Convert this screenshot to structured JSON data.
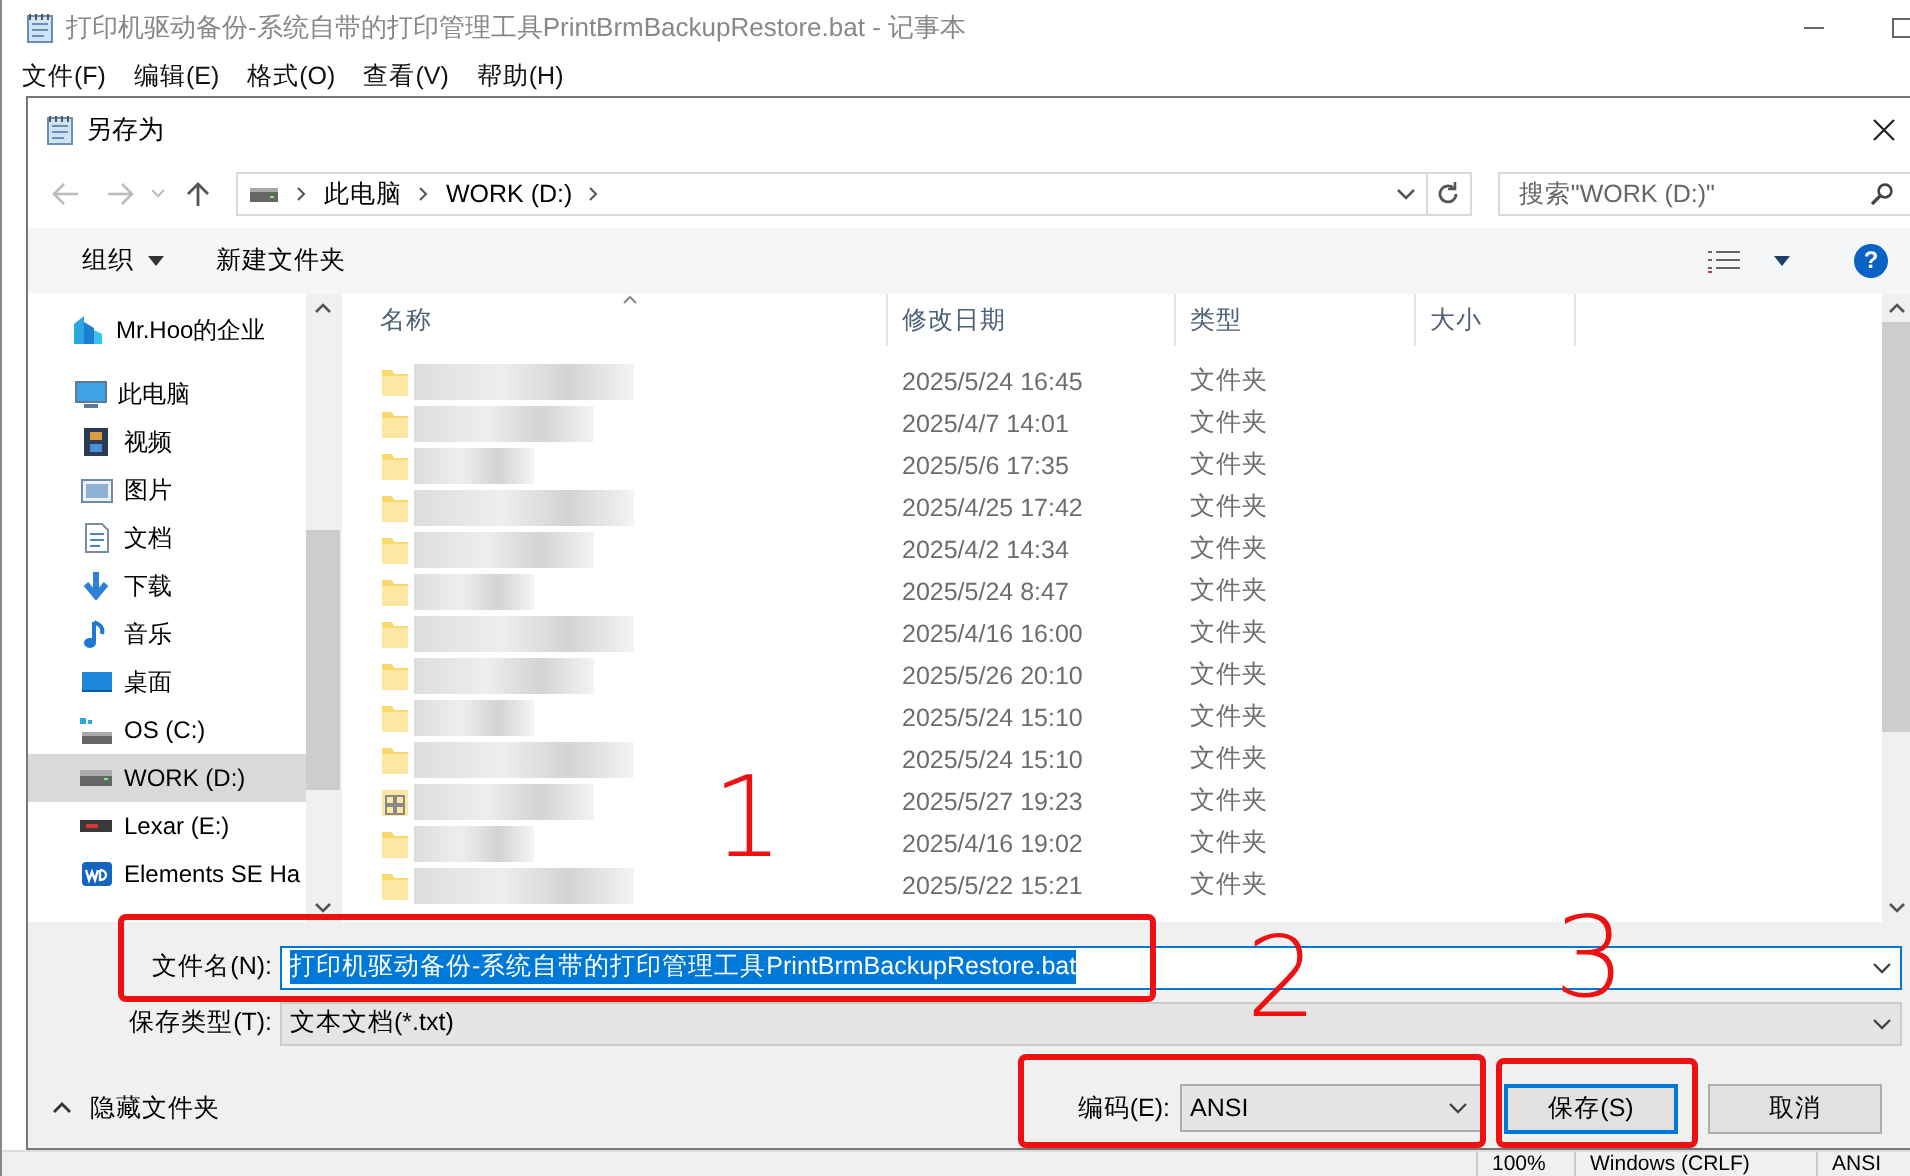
{
  "notepad": {
    "title": "打印机驱动备份-系统自带的打印管理工具PrintBrmBackupRestore.bat - 记事本",
    "menu": [
      "文件(F)",
      "编辑(E)",
      "格式(O)",
      "查看(V)",
      "帮助(H)"
    ],
    "status_bar": [
      "100%",
      "Windows (CRLF)",
      "ANSI"
    ]
  },
  "dialog": {
    "title": "另存为",
    "address": {
      "path": [
        "此电脑",
        "WORK (D:)"
      ]
    },
    "search": {
      "placeholder": "搜索\"WORK (D:)\""
    },
    "toolbar": {
      "organize": "组织",
      "new_folder": "新建文件夹",
      "help": "?"
    },
    "sidebar": {
      "items": [
        {
          "kind": "cloud",
          "label": "Mr.Hoo的企业",
          "selected": false
        },
        {
          "kind": "pc",
          "label": "此电脑",
          "selected": false
        },
        {
          "kind": "video",
          "label": "视频",
          "selected": false
        },
        {
          "kind": "picture",
          "label": "图片",
          "selected": false
        },
        {
          "kind": "document",
          "label": "文档",
          "selected": false
        },
        {
          "kind": "download",
          "label": "下载",
          "selected": false
        },
        {
          "kind": "music",
          "label": "音乐",
          "selected": false
        },
        {
          "kind": "desktop",
          "label": "桌面",
          "selected": false
        },
        {
          "kind": "osdrive",
          "label": "OS (C:)",
          "selected": false
        },
        {
          "kind": "drive",
          "label": "WORK (D:)",
          "selected": true
        },
        {
          "kind": "usb",
          "label": "Lexar (E:)",
          "selected": false
        },
        {
          "kind": "wd",
          "label": "Elements SE Ha",
          "selected": false
        }
      ]
    },
    "table": {
      "columns": [
        "名称",
        "修改日期",
        "类型",
        "大小"
      ],
      "rows": [
        {
          "kind": "folder",
          "date": "2025/5/24 16:45",
          "type": "文件夹"
        },
        {
          "kind": "folder",
          "date": "2025/4/7 14:01",
          "type": "文件夹"
        },
        {
          "kind": "folder",
          "date": "2025/5/6 17:35",
          "type": "文件夹"
        },
        {
          "kind": "folder",
          "date": "2025/4/25 17:42",
          "type": "文件夹"
        },
        {
          "kind": "folder",
          "date": "2025/4/2 14:34",
          "type": "文件夹"
        },
        {
          "kind": "folder",
          "date": "2025/5/24 8:47",
          "type": "文件夹"
        },
        {
          "kind": "folder",
          "date": "2025/4/16 16:00",
          "type": "文件夹"
        },
        {
          "kind": "folder",
          "date": "2025/5/26 20:10",
          "type": "文件夹"
        },
        {
          "kind": "folder",
          "date": "2025/5/24 15:10",
          "type": "文件夹"
        },
        {
          "kind": "folder",
          "date": "2025/5/24 15:10",
          "type": "文件夹"
        },
        {
          "kind": "app",
          "date": "2025/5/27 19:23",
          "type": "文件夹"
        },
        {
          "kind": "folder",
          "date": "2025/4/16 19:02",
          "type": "文件夹"
        },
        {
          "kind": "folder",
          "date": "2025/5/22 15:21",
          "type": "文件夹"
        }
      ]
    },
    "filename": {
      "label": "文件名(N):",
      "value": "打印机驱动备份-系统自带的打印管理工具PrintBrmBackupRestore.bat"
    },
    "filetype": {
      "label": "保存类型(T):",
      "value": "文本文档(*.txt)"
    },
    "hide_folders": "隐藏文件夹",
    "encoding": {
      "label": "编码(E):",
      "value": "ANSI"
    },
    "buttons": [
      {
        "label": "保存(S)",
        "default": true
      },
      {
        "label": "取消",
        "default": false
      }
    ]
  },
  "annotations": [
    {
      "kind": "box"
    },
    {
      "kind": "box"
    },
    {
      "kind": "box"
    },
    {
      "kind": "digit",
      "text": "1"
    },
    {
      "kind": "digit",
      "text": "2"
    },
    {
      "kind": "digit",
      "text": "3"
    }
  ]
}
